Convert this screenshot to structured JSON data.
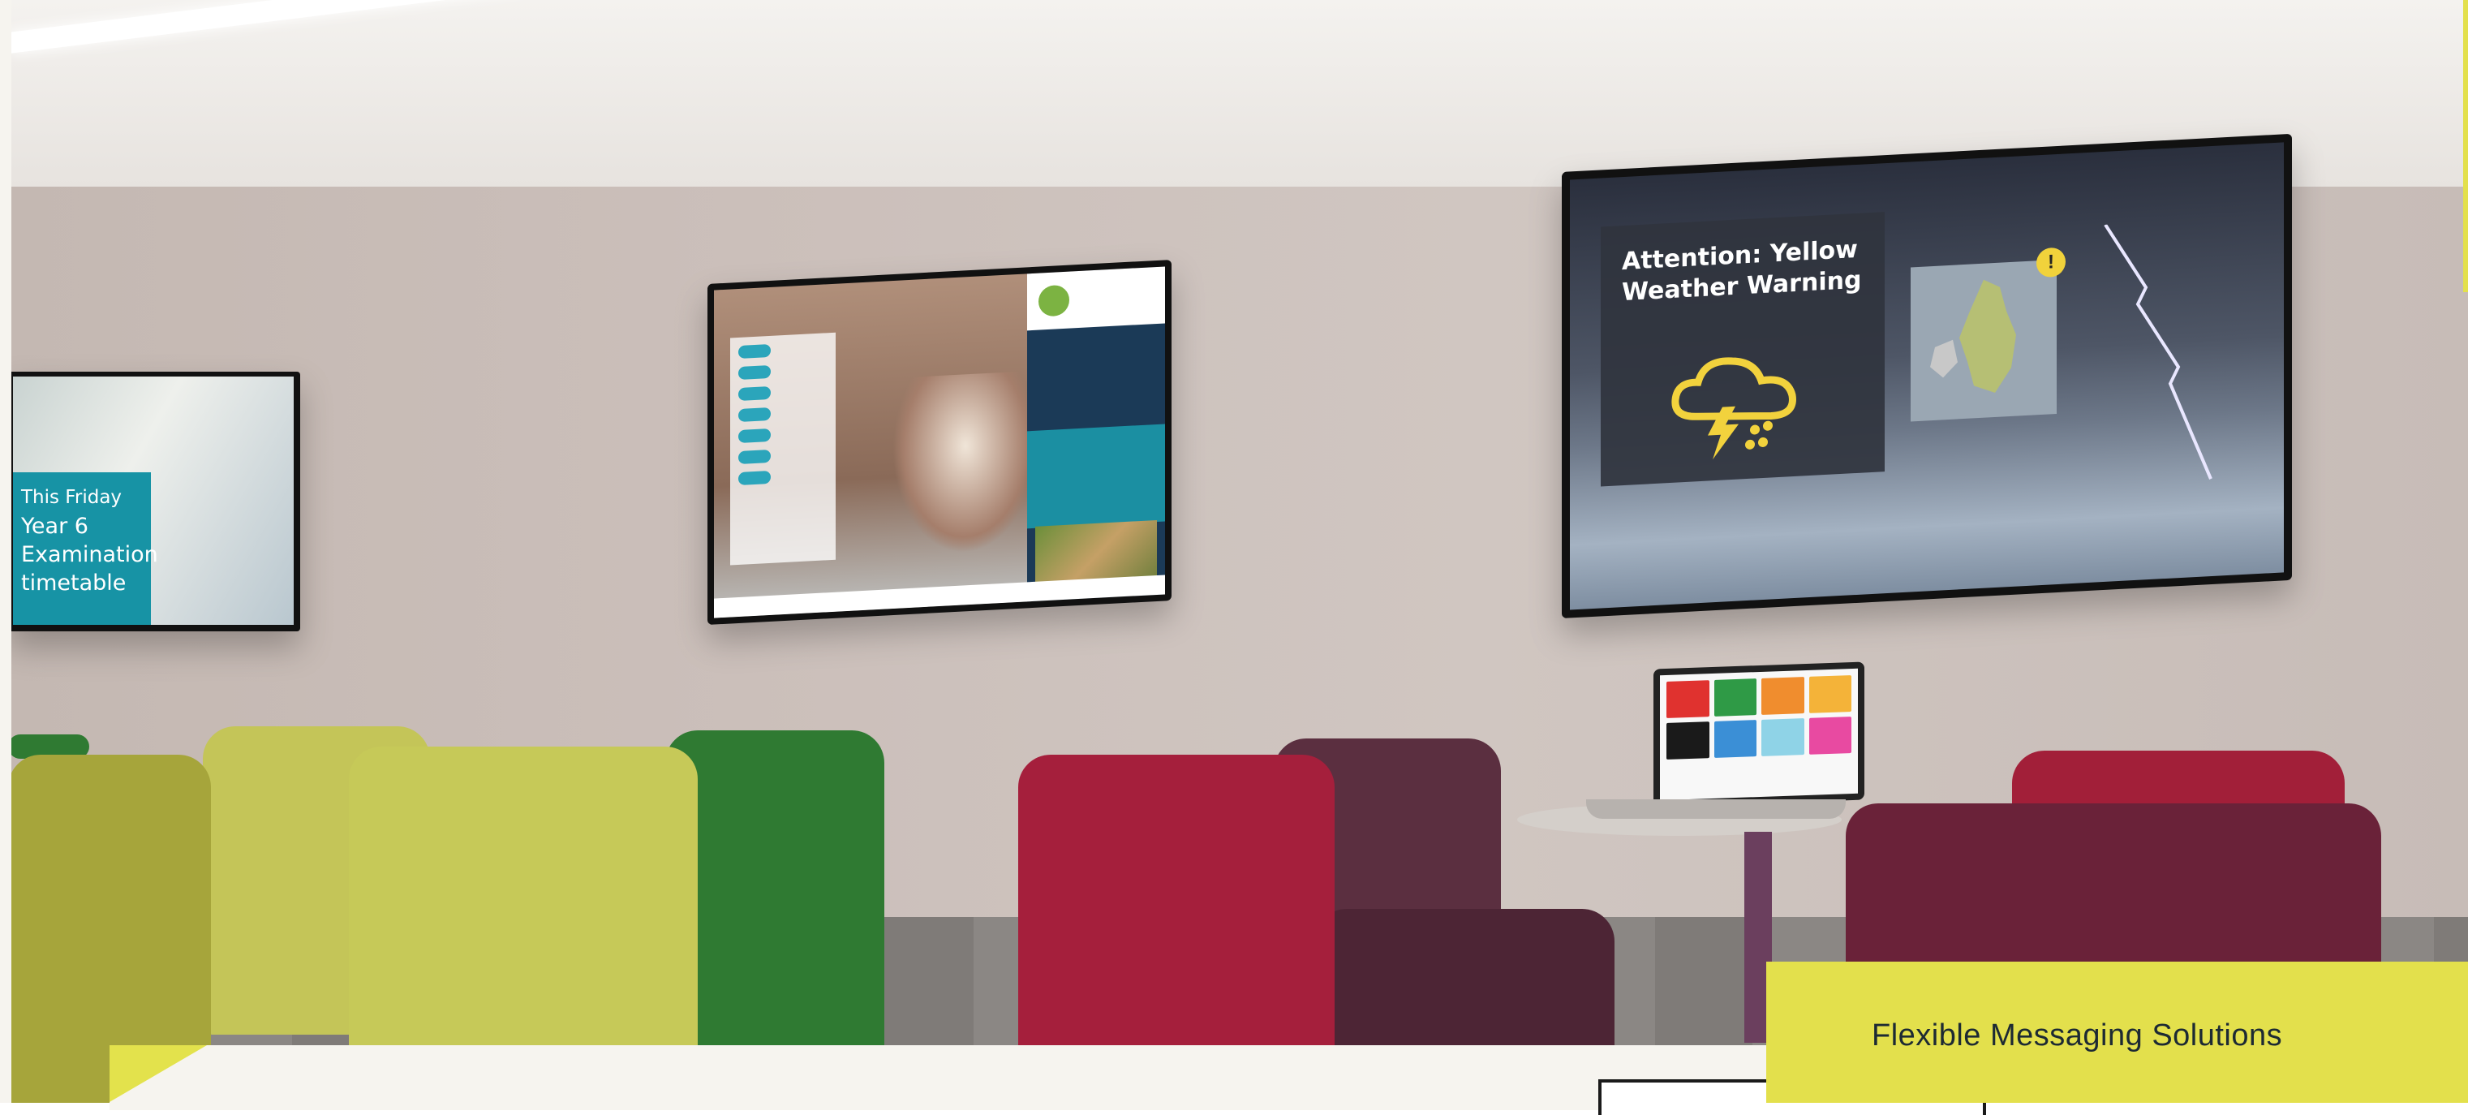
{
  "screens": {
    "left": {
      "lines": [
        "This Friday",
        "Year 6",
        "Examination",
        "timetable"
      ]
    },
    "right": {
      "alert_title_line1": "Attention: Yellow",
      "alert_title_line2": "Weather Warning",
      "warning_symbol": "!"
    }
  },
  "headline": "Flexible Messaging Solutions",
  "colors": {
    "accent_yellow": "#e3e04c",
    "teal": "#1793a5",
    "navy": "#1b3a57"
  },
  "icons": [
    "storm-cloud-icon",
    "warning-icon",
    "lightning-bolt-icon"
  ]
}
